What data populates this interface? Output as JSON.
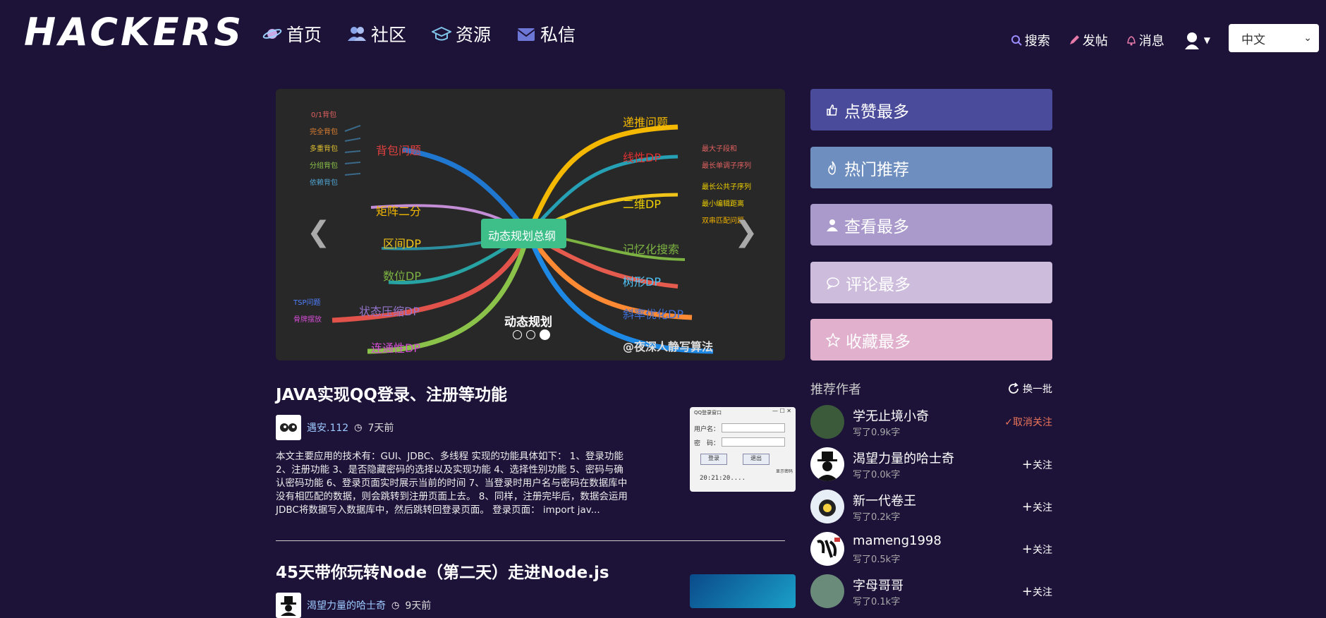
{
  "brand": {
    "logo": "HACKERS"
  },
  "nav": [
    {
      "label": "首页",
      "icon": "planet-icon"
    },
    {
      "label": "社区",
      "icon": "users-icon"
    },
    {
      "label": "资源",
      "icon": "graduation-cap-icon"
    },
    {
      "label": "私信",
      "icon": "mail-icon"
    }
  ],
  "header": {
    "search_label": "搜索",
    "post_label": "发帖",
    "messages_label": "消息",
    "language": "中文"
  },
  "carousel": {
    "center_node": "动态规划总纲",
    "caption": "动态规划",
    "watermark": "@夜深人静写算法",
    "left_nodes": [
      "背包问题",
      "矩阵二分",
      "区间DP",
      "数位DP",
      "状态压缩DP",
      "连通性DP"
    ],
    "knapsack_items": [
      "0/1背包",
      "完全背包",
      "多重背包",
      "分组背包",
      "依赖背包"
    ],
    "compression_items": [
      "TSP问题",
      "骨牌摆放"
    ],
    "right_nodes": [
      "递推问题",
      "线性DP",
      "二维DP",
      "记忆化搜索",
      "树形DP",
      "斜率优化DP"
    ],
    "linear_items": [
      "最大子段和",
      "最长单调子序列"
    ],
    "twod_items": [
      "最长公共子序列",
      "最小编辑距离",
      "双串匹配问题"
    ],
    "slide_count": 3,
    "active_slide": 3
  },
  "sidebar_buttons": [
    {
      "label": "点赞最多",
      "icon": "thumbs-up-icon",
      "color": "#4a4b9b"
    },
    {
      "label": "热门推荐",
      "icon": "fire-icon",
      "color": "#6d8ebf"
    },
    {
      "label": "查看最多",
      "icon": "user-icon",
      "color": "#a99acb"
    },
    {
      "label": "评论最多",
      "icon": "comment-icon",
      "color": "#cdbcdc"
    },
    {
      "label": "收藏最多",
      "icon": "star-icon",
      "color": "#e0b0cd"
    }
  ],
  "articles": [
    {
      "title": "JAVA实现QQ登录、注册等功能",
      "author": "遇安.112",
      "time": "7天前",
      "excerpt": "本文主要应用的技术有：GUI、JDBC、多线程 实现的功能具体如下： 1、登录功能 2、注册功能 3、是否隐藏密码的选择以及实现功能 4、选择性别功能 5、密码与确认密码功能 6、登录页面实时展示当前的时间 7、当登录时用户名与密码在数据库中没有相匹配的数据，则会跳转到注册页面上去。 8、同样，注册完毕后，数据会运用JDBC将数据写入数据库中，然后跳转回登录页面。 登录页面： import jav...",
      "thumb": {
        "window_title": "QQ登录窗口",
        "user_label": "用户名：",
        "pwd_label": "密　码：",
        "login": "登录",
        "exit": "退出",
        "clock": "20:21:20....",
        "hide_pwd": "显示密码"
      }
    },
    {
      "title": "45天带你玩转Node（第二天）走进Node.js",
      "author": "渴望力量的哈士奇",
      "time": "9天前"
    }
  ],
  "recommend": {
    "title": "推荐作者",
    "refresh_label": "换一批",
    "authors": [
      {
        "name": "学无止境小奇",
        "words": "写了0.9k字",
        "action": "取消关注"
      },
      {
        "name": "渴望力量的哈士奇",
        "words": "写了0.0k字",
        "action": "关注"
      },
      {
        "name": "新一代卷王",
        "words": "写了0.2k字",
        "action": "关注"
      },
      {
        "name": "mameng1998",
        "words": "写了0.5k字",
        "action": "关注"
      },
      {
        "name": "字母哥哥",
        "words": "写了0.1k字",
        "action": "关注"
      }
    ]
  }
}
